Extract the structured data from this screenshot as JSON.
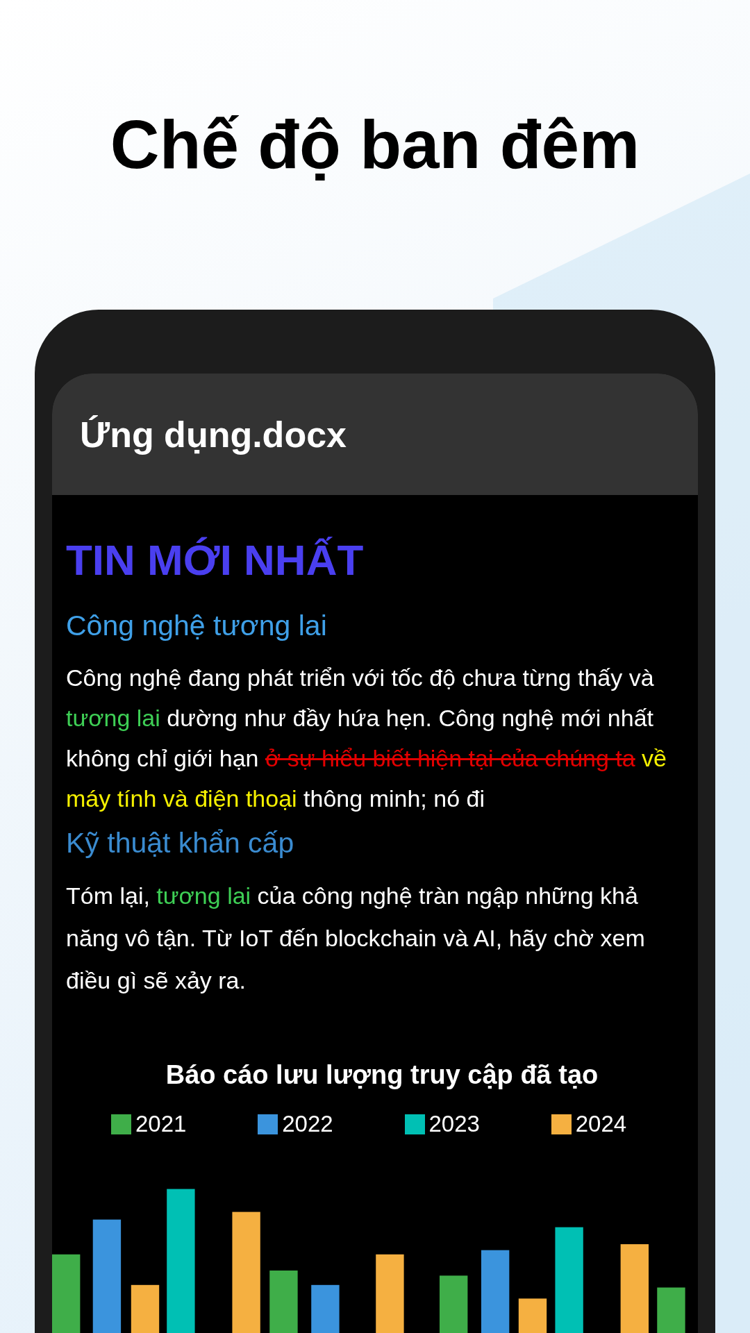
{
  "headline": "Chế độ ban đêm",
  "document": {
    "title": "Ứng dụng.docx",
    "heading": "TIN MỚI NHẤT",
    "sections": [
      {
        "subheading": "Công nghệ tương lai",
        "paragraph": [
          {
            "kind": "normal",
            "text": "Công nghệ đang phát triển với tốc độ chưa từng thấy và "
          },
          {
            "kind": "green",
            "text": "tương lai"
          },
          {
            "kind": "normal",
            "text": " dường như đầy hứa hẹn. Công nghệ mới nhất không chỉ giới hạn "
          },
          {
            "kind": "strikethrough",
            "text": "ở sự hiểu biết hiện tại của chúng ta"
          },
          {
            "kind": "yellow",
            "text": " về máy tính và điện thoại"
          },
          {
            "kind": "normal",
            "text": " thông minh; nó đi"
          }
        ]
      },
      {
        "subheading": "Kỹ thuật khẩn cấp",
        "paragraph": [
          {
            "kind": "normal",
            "text": "Tóm lại, "
          },
          {
            "kind": "green",
            "text": "tương lai"
          },
          {
            "kind": "normal",
            "text": " của công nghệ tràn ngập những khả năng vô tận. Từ IoT đến blockchain và AI, hãy chờ xem điều gì sẽ xảy ra."
          }
        ]
      }
    ],
    "chart": {
      "title": "Báo cáo lưu lượng truy cập đã tạo",
      "legend": [
        {
          "label": "2021",
          "color": "#3fae49"
        },
        {
          "label": "2022",
          "color": "#3b94dd"
        },
        {
          "label": "2023",
          "color": "#00c0b4"
        },
        {
          "label": "2024",
          "color": "#f5b041"
        }
      ]
    }
  }
}
